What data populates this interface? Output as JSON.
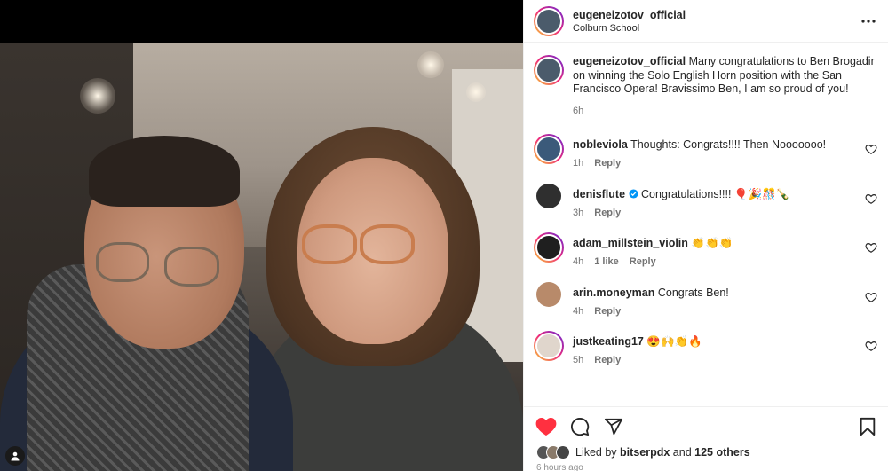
{
  "post": {
    "username": "eugeneizotov_official",
    "location": "Colburn School",
    "caption": {
      "username": "eugeneizotov_official",
      "text": "Many congratulations to Ben Brogadir on winning the Solo English Horn position with the San Francisco Opera! Bravissimo Ben, I am so proud of you!",
      "time": "6h"
    },
    "comments": [
      {
        "username": "nobleviola",
        "text": "Thoughts: Congrats!!!! Then Nooooooo!",
        "time": "1h",
        "likes": "",
        "reply": "Reply"
      },
      {
        "username": "denisflute",
        "text": "Congratulations!!!! 🎈🎉🎊🍾",
        "time": "3h",
        "likes": "",
        "reply": "Reply"
      },
      {
        "username": "adam_millstein_violin",
        "text": "👏👏👏",
        "time": "4h",
        "likes": "1 like",
        "reply": "Reply"
      },
      {
        "username": "arin.moneyman",
        "text": "Congrats Ben!",
        "time": "4h",
        "likes": "",
        "reply": "Reply"
      },
      {
        "username": "justkeating17",
        "text": "😍🙌👏🔥",
        "time": "5h",
        "likes": "",
        "reply": "Reply"
      }
    ],
    "liked_by": {
      "prefix": "Liked by",
      "user": "bitserpdx",
      "and": "and",
      "others": "125 others"
    },
    "timestamp": "6 hours ago"
  },
  "colors": {
    "like_red": "#ff3040",
    "verified_blue": "#0095f6",
    "text": "#262626",
    "muted": "#737373"
  },
  "icons": [
    "user-tag-icon",
    "more-options-icon",
    "heart-icon",
    "comment-icon",
    "share-icon",
    "bookmark-icon",
    "verified-icon"
  ]
}
